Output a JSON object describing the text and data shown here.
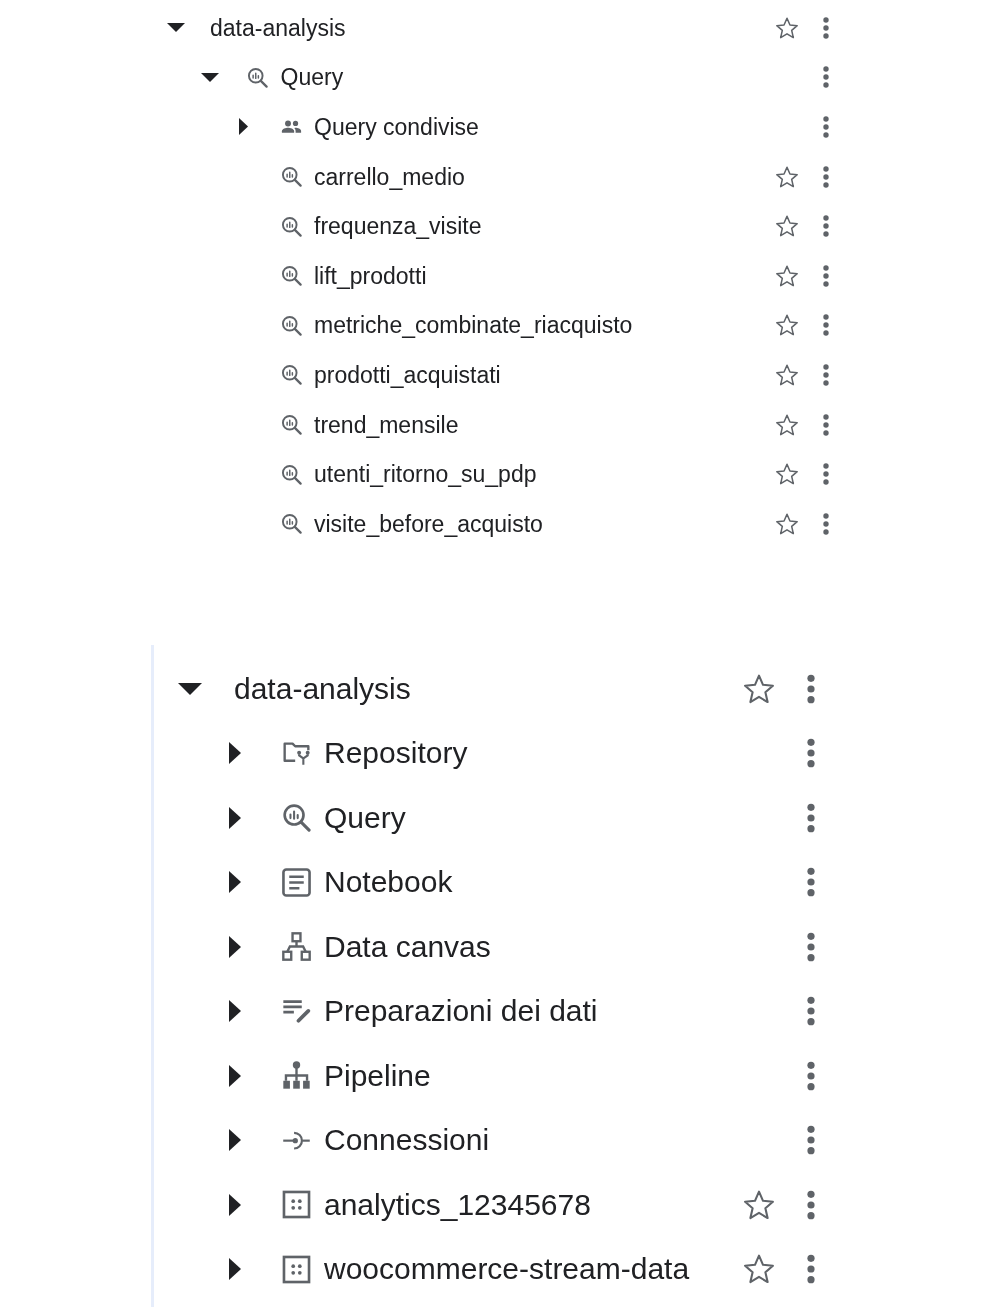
{
  "panels": [
    {
      "tree": [
        {
          "label": "data-analysis",
          "kind": "project",
          "expanded": true,
          "starred": false,
          "children": [
            {
              "label": "Query",
              "kind": "query_folder",
              "expanded": true,
              "children": [
                {
                  "label": "Query condivise",
                  "kind": "shared_folder",
                  "expanded": false
                },
                {
                  "label": "carrello_medio",
                  "kind": "query",
                  "starred": false
                },
                {
                  "label": "frequenza_visite",
                  "kind": "query",
                  "starred": false
                },
                {
                  "label": "lift_prodotti",
                  "kind": "query",
                  "starred": false
                },
                {
                  "label": "metriche_combinate_riacquisto",
                  "kind": "query",
                  "starred": false
                },
                {
                  "label": "prodotti_acquistati",
                  "kind": "query",
                  "starred": false
                },
                {
                  "label": "trend_mensile",
                  "kind": "query",
                  "starred": false
                },
                {
                  "label": "utenti_ritorno_su_pdp",
                  "kind": "query",
                  "starred": false
                },
                {
                  "label": "visite_before_acquisto",
                  "kind": "query",
                  "starred": false
                }
              ]
            }
          ]
        }
      ]
    },
    {
      "tree": [
        {
          "label": "data-analysis",
          "kind": "project",
          "expanded": true,
          "starred": false,
          "children": [
            {
              "label": "Repository",
              "kind": "repository",
              "expanded": false
            },
            {
              "label": "Query",
              "kind": "query_folder",
              "expanded": false
            },
            {
              "label": "Notebook",
              "kind": "notebook_folder",
              "expanded": false
            },
            {
              "label": "Data canvas",
              "kind": "canvas_folder",
              "expanded": false
            },
            {
              "label": "Preparazioni dei dati",
              "kind": "prep_folder",
              "expanded": false
            },
            {
              "label": "Pipeline",
              "kind": "pipeline_folder",
              "expanded": false
            },
            {
              "label": "Connessioni",
              "kind": "connection_folder",
              "expanded": false
            },
            {
              "label": "analytics_12345678",
              "kind": "dataset",
              "expanded": false,
              "starred": false
            },
            {
              "label": "woocommerce-stream-data",
              "kind": "dataset",
              "expanded": false,
              "starred": false
            }
          ]
        }
      ]
    }
  ]
}
